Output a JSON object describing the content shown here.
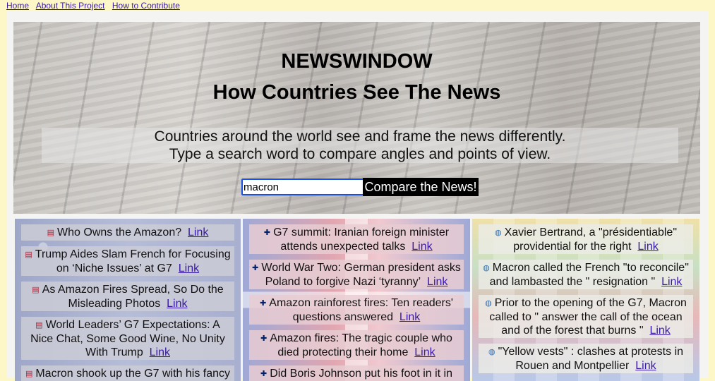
{
  "nav": {
    "home": "Home",
    "about": "About This Project",
    "contribute": "How to Contribute"
  },
  "hero": {
    "title": "NEWSWINDOW",
    "subtitle": "How Countries See The News",
    "tagline_line1": "Countries around the world see and frame the news differently.",
    "tagline_line2": "Type a search word to compare angles and points of view.",
    "search_value": "macron",
    "search_button": "Compare the News!"
  },
  "link_text": "Link",
  "columns": {
    "us": {
      "flag_icon": "us-flag-icon",
      "items": [
        "Who Owns the Amazon?",
        "Trump Aides Slam French for Focusing on ‘Niche Issues’ at G7",
        "As Amazon Fires Spread, So Do the Misleading Photos",
        "World Leaders’ G7 Expectations: A Nice Chat, Some Good Wine, No Unity With Trump",
        "Macron shook up the G7 with his fancy"
      ]
    },
    "uk": {
      "flag_icon": "uk-flag-icon",
      "items": [
        "G7 summit: Iranian foreign minister attends unexpected talks",
        "World War Two: German president asks Poland to forgive Nazi ‘tyranny’",
        "Amazon rainforest fires: Ten readers' questions answered",
        "Amazon fires: The tragic couple who died protecting their home",
        "Did Boris Johnson put his foot in it in"
      ]
    },
    "world": {
      "flag_icon": "globe-icon",
      "items": [
        "Xavier Bertrand, a \"présidentiable\" providential for the right",
        "Macron called the French \"to reconcile\" and lambasted the \" resignation \"",
        "Prior to the opening of the G7, Macron called to \" answer the call of the ocean and of the forest that burns \"",
        "\"Yellow vests\" : clashes at protests in Rouen and Montpellier"
      ]
    }
  }
}
